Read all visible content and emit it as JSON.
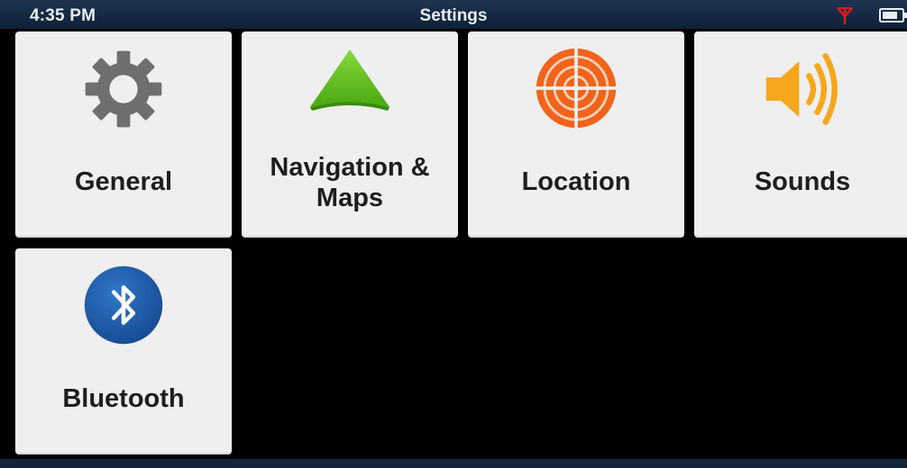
{
  "status_bar": {
    "time": "4:35 PM",
    "title": "Settings",
    "gps_icon": "antenna-icon",
    "battery_icon": "battery-icon",
    "gps_color": "#e0161b"
  },
  "tiles": [
    {
      "label": "General",
      "icon": "gear-icon"
    },
    {
      "label_line1": "Navigation &",
      "label_line2": "Maps",
      "icon": "navigation-arrow-icon"
    },
    {
      "label": "Location",
      "icon": "target-icon"
    },
    {
      "label": "Sounds",
      "icon": "speaker-icon"
    },
    {
      "label": "Bluetooth",
      "icon": "bluetooth-icon"
    }
  ],
  "colors": {
    "tile_bg": "#efefef",
    "background": "#000000",
    "nav_green": "#5fc21a",
    "location_orange": "#f2631c",
    "sound_yellow": "#f6a81c",
    "bluetooth_blue": "#1f5fae"
  }
}
